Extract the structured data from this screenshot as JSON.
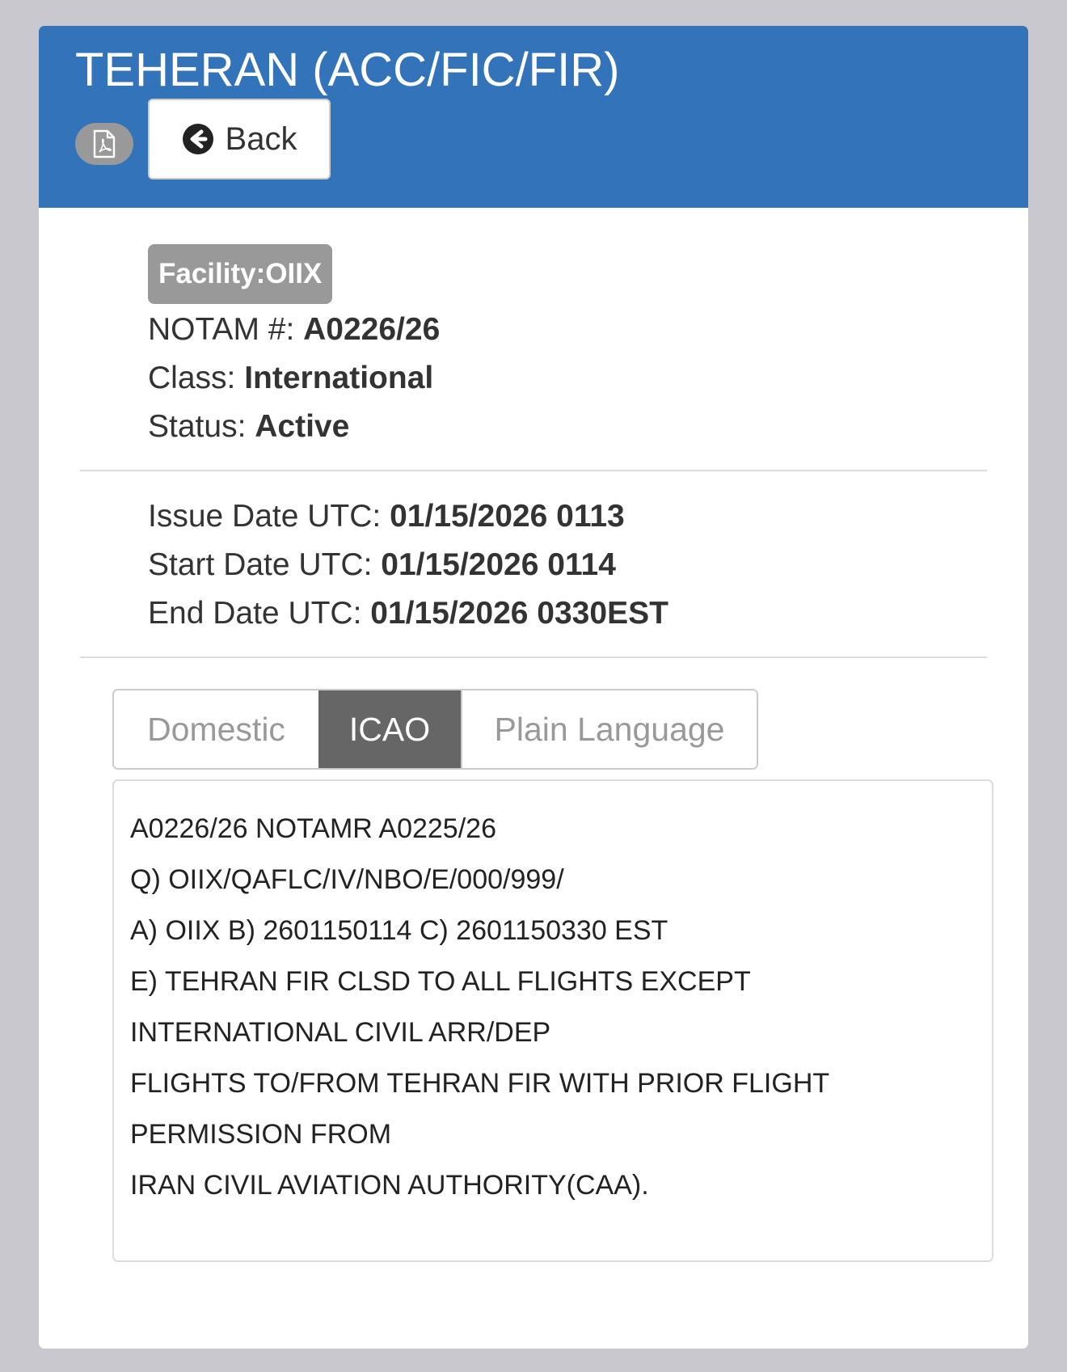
{
  "header": {
    "title": "TEHERAN (ACC/FIC/FIR)",
    "pdf_icon": "pdf-file-icon",
    "back_icon": "arrow-left-circle-icon",
    "back_label": "Back",
    "color": "#3373ba"
  },
  "details": {
    "facility_label": "Facility:",
    "facility_value": "OIIX",
    "notam_label": "NOTAM #:",
    "notam_value": "A0226/26",
    "class_label": "Class:",
    "class_value": "International",
    "status_label": "Status:",
    "status_value": "Active"
  },
  "dates": {
    "issue_label": "Issue Date UTC:",
    "issue_value": "01/15/2026 0113",
    "start_label": "Start Date UTC:",
    "start_value": "01/15/2026 0114",
    "end_label": "End Date UTC:",
    "end_value": "01/15/2026 0330EST"
  },
  "tabs": [
    {
      "label": "Domestic",
      "active": false
    },
    {
      "label": "ICAO",
      "active": true
    },
    {
      "label": "Plain Language",
      "active": false
    }
  ],
  "notam_text": [
    "A0226/26 NOTAMR A0225/26",
    "Q) OIIX/QAFLC/IV/NBO/E/000/999/",
    "A) OIIX B) 2601150114 C) 2601150330 EST",
    "E) TEHRAN FIR CLSD TO ALL FLIGHTS EXCEPT",
    "INTERNATIONAL CIVIL ARR/DEP",
    "FLIGHTS TO/FROM TEHRAN FIR WITH PRIOR FLIGHT",
    "PERMISSION FROM",
    "IRAN CIVIL AVIATION AUTHORITY(CAA)."
  ]
}
